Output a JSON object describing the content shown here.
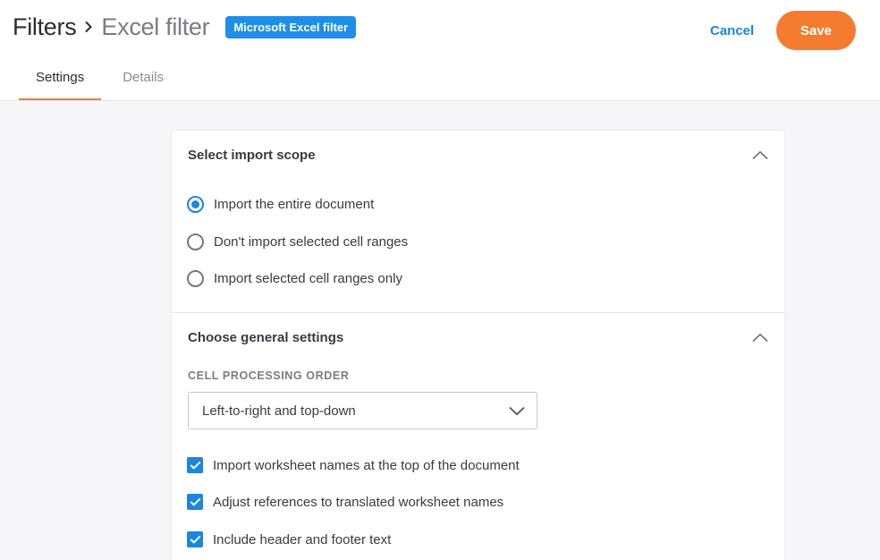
{
  "header": {
    "breadcrumb_root": "Filters",
    "breadcrumb_current": "Excel filter",
    "badge": "Microsoft Excel filter",
    "cancel_label": "Cancel",
    "save_label": "Save"
  },
  "tabs": [
    {
      "label": "Settings",
      "active": true
    },
    {
      "label": "Details",
      "active": false
    }
  ],
  "import_scope": {
    "title": "Select import scope",
    "options": [
      {
        "label": "Import the entire document",
        "checked": true
      },
      {
        "label": "Don't import selected cell ranges",
        "checked": false
      },
      {
        "label": "Import selected cell ranges only",
        "checked": false
      }
    ]
  },
  "general_settings": {
    "title": "Choose general settings",
    "cell_processing_order": {
      "label": "CELL PROCESSING ORDER",
      "value": "Left-to-right and top-down"
    },
    "checkboxes": [
      {
        "label": "Import worksheet names at the top of the document",
        "checked": true
      },
      {
        "label": "Adjust references to translated worksheet names",
        "checked": true
      },
      {
        "label": "Include header and footer text",
        "checked": true
      }
    ]
  },
  "colors": {
    "accent_orange": "#f57c2e",
    "link_blue": "#1b86df",
    "badge_blue": "#1e8ee8"
  },
  "icons": {
    "breadcrumb_separator": "chevron-right-icon",
    "collapse": "chevron-up-icon",
    "dropdown": "chevron-down-icon",
    "radio_checked": "radio-checked-icon",
    "radio_unchecked": "radio-unchecked-icon",
    "checkbox_checked": "checkbox-checked-icon"
  }
}
